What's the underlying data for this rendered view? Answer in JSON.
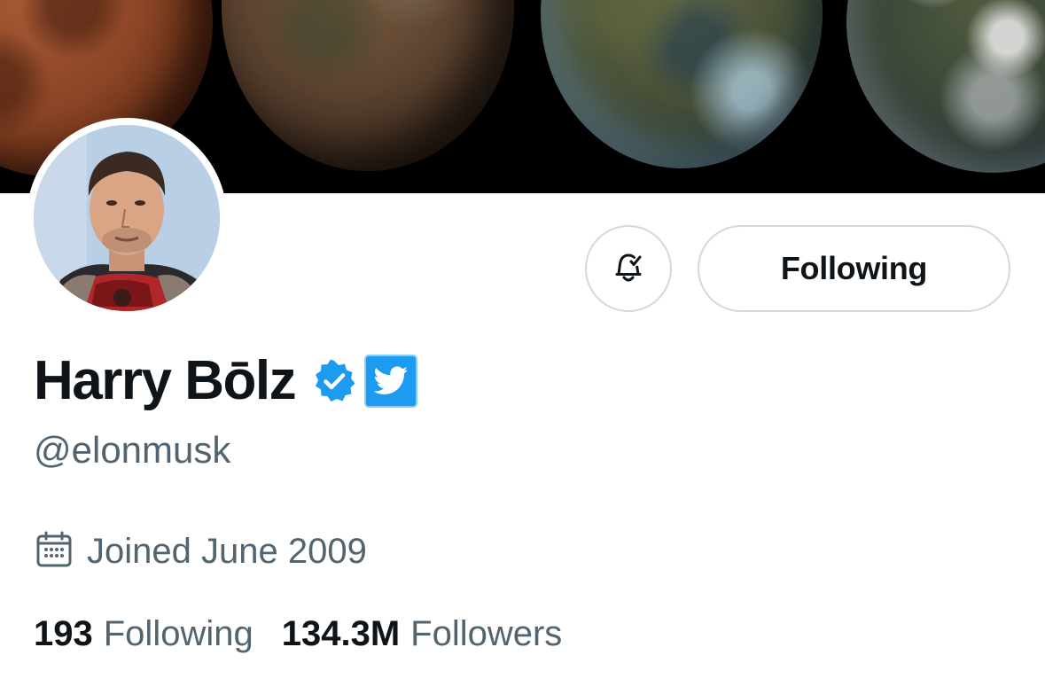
{
  "banner": {
    "image": "planet-terraforming-sequence"
  },
  "profile": {
    "avatar_image": "profile-photo",
    "display_name": "Harry Bōlz",
    "handle": "@elonmusk",
    "badges": [
      "verified-check-icon",
      "twitter-bird-badge-icon"
    ],
    "joined_text": "Joined June 2009"
  },
  "actions": {
    "notifications_icon": "bell-check-icon",
    "following_label": "Following"
  },
  "stats": {
    "following_count": "193",
    "following_label": "Following",
    "followers_count": "134.3M",
    "followers_label": "Followers"
  },
  "colors": {
    "accent": "#1d9bf0",
    "text_primary": "#0f1419",
    "text_secondary": "#536471",
    "border": "#cfd9de"
  }
}
